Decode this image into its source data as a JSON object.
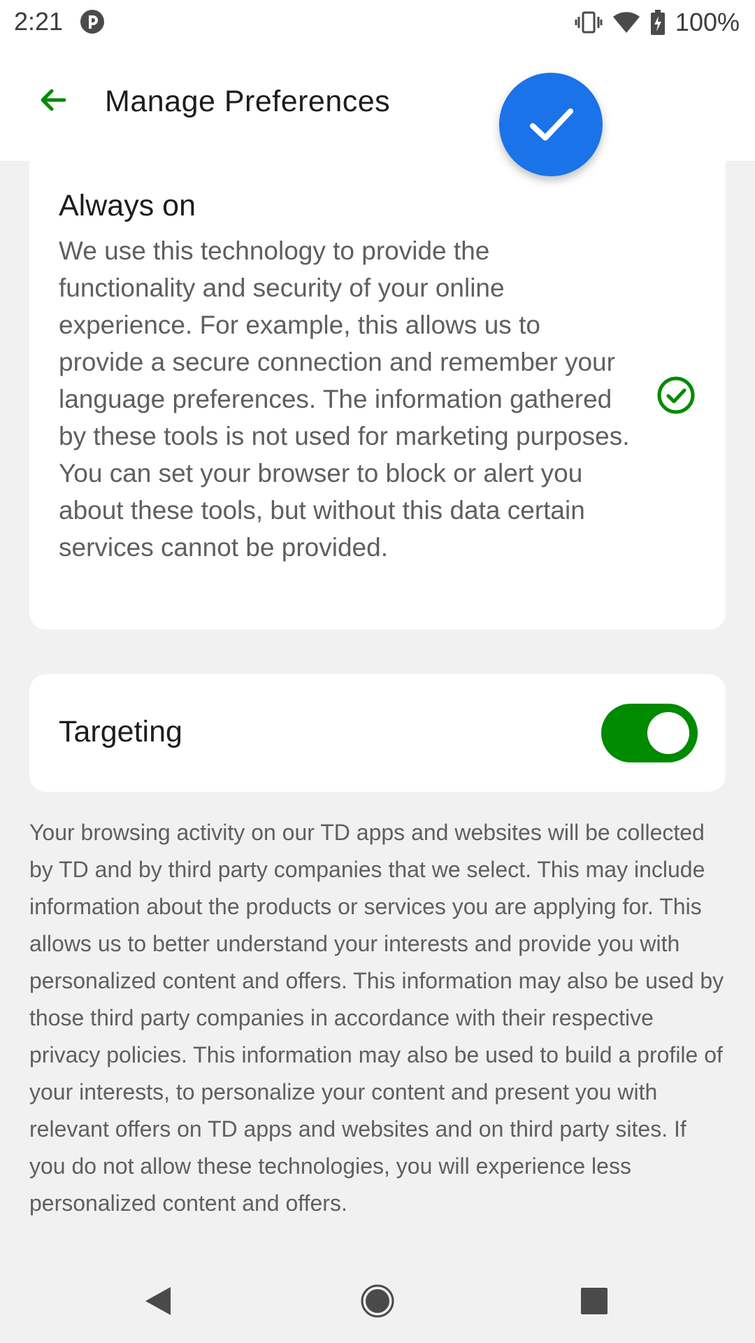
{
  "status_bar": {
    "time": "2:21",
    "battery": "100%"
  },
  "header": {
    "title": "Manage Preferences"
  },
  "always_on": {
    "title": "Always on",
    "description": "We use this technology to provide the functionality and security of your online experience. For example, this allows us to provide a secure connection and remember your language preferences. The information gathered by these tools is not used for marketing purposes. You can set your browser to block or alert you about these tools, but without this data certain services cannot be provided."
  },
  "targeting": {
    "title": "Targeting",
    "enabled": true,
    "description": "Your browsing activity on our TD apps and websites will be collected by TD and by third party companies that we select. This may include information about the products or services you are applying for. This allows us to better understand your interests and provide you with personalized content and offers. This information may also be used by those third party companies in accordance with their respective privacy policies. This information may also be used to build a profile of your interests, to personalize your content and present you with relevant offers on TD apps and websites and on third party sites. If you do not allow these technologies, you will experience less personalized content and offers."
  },
  "colors": {
    "accent_green": "#008a00",
    "fab_blue": "#1a73e8"
  },
  "icons": {
    "back": "arrow-left-icon",
    "confirm": "check-icon",
    "always_on_status": "check-circle-icon"
  }
}
